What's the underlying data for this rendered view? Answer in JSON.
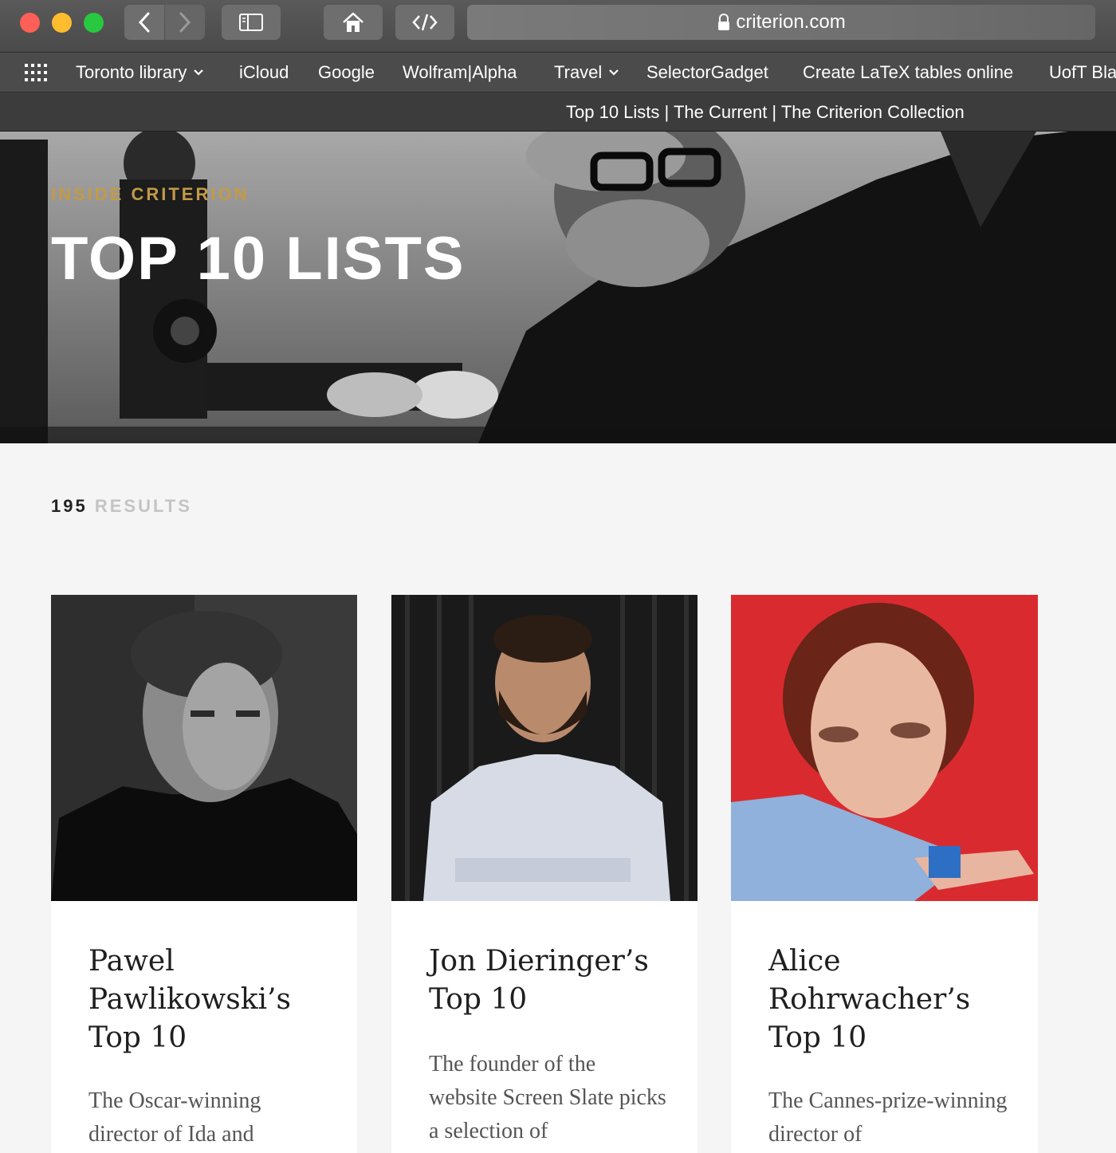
{
  "browser": {
    "url": "criterion.com",
    "tab_title": "Top 10 Lists | The Current | The Criterion Collection",
    "bookmarks": [
      {
        "label": "Toronto library",
        "has_menu": true
      },
      {
        "label": "iCloud",
        "has_menu": false
      },
      {
        "label": "Google",
        "has_menu": false
      },
      {
        "label": "Wolfram|Alpha",
        "has_menu": false
      },
      {
        "label": "Travel",
        "has_menu": true
      },
      {
        "label": "SelectorGadget",
        "has_menu": false
      },
      {
        "label": "Create LaTeX tables online",
        "has_menu": false
      },
      {
        "label": "UofT Bla",
        "has_menu": false
      }
    ]
  },
  "hero": {
    "eyebrow": "INSIDE CRITERION",
    "title": "TOP 10 LISTS"
  },
  "results": {
    "count": "195",
    "label": "RESULTS"
  },
  "cards": [
    {
      "title": "Pawel Pawlikowski’s Top 10",
      "description": "The Oscar-winning director of Ida and",
      "photo": "portrait-bw-man"
    },
    {
      "title": "Jon Dieringer’s Top 10",
      "description": "The founder of the website Screen Slate picks a selection of",
      "photo": "portrait-bearded-man"
    },
    {
      "title": "Alice Rohrwacher’s Top 10",
      "description": "The Cannes-prize-winning director of",
      "photo": "portrait-woman-red-background"
    }
  ],
  "colors": {
    "accent_gold": "#c39a47",
    "page_background": "#f5f5f5",
    "card_background": "#ffffff"
  }
}
